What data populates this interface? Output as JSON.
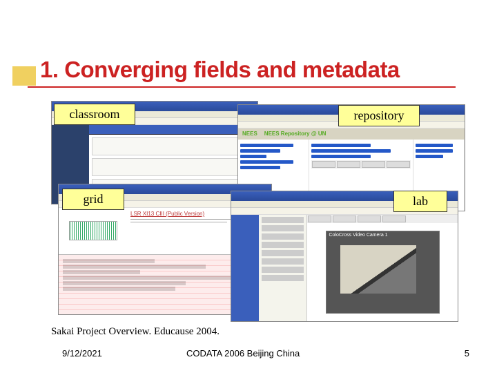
{
  "title": "1. Converging fields and metadata",
  "labels": {
    "classroom": "classroom",
    "repository": "repository",
    "grid": "grid",
    "lab": "lab"
  },
  "repo_header": "NEES Repository @ UN",
  "grid_title": "LSR XI13 CIII (Public Version)",
  "video_caption": "ColoCross Video Camera 1",
  "citation": "Sakai Project Overview. Educause 2004.",
  "footer": {
    "date": "9/12/2021",
    "venue": "CODATA 2006 Beijing China",
    "page": "5"
  }
}
